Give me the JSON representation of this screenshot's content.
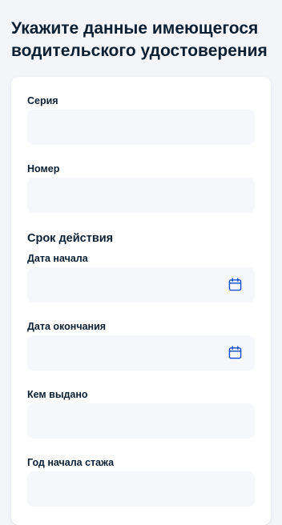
{
  "page": {
    "title": "Укажите данные имеющегося водительского удостоверения"
  },
  "form": {
    "series": {
      "label": "Серия",
      "value": ""
    },
    "number": {
      "label": "Номер",
      "value": ""
    },
    "validity": {
      "title": "Срок действия"
    },
    "start_date": {
      "label": "Дата начала",
      "value": "",
      "icon": "calendar-icon"
    },
    "end_date": {
      "label": "Дата окончания",
      "value": "",
      "icon": "calendar-icon"
    },
    "issued_by": {
      "label": "Кем выдано",
      "value": ""
    },
    "experience_start_year": {
      "label": "Год начала стажа",
      "value": ""
    }
  },
  "colors": {
    "background": "#f3f5f9",
    "card": "#ffffff",
    "input_fill": "#f5f7fa",
    "text": "#0b1f33",
    "icon": "#0d4cd3"
  }
}
